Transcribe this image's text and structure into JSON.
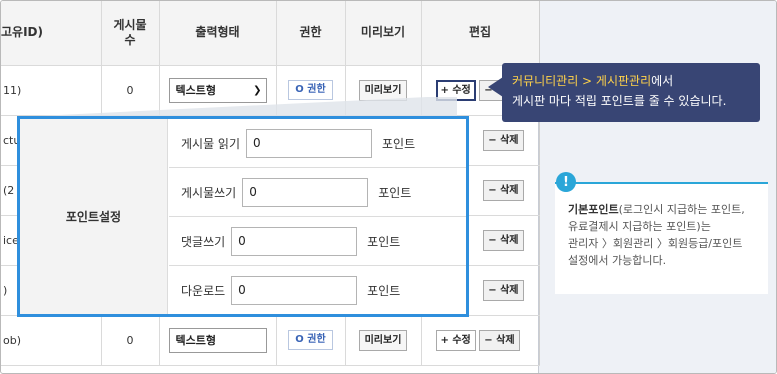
{
  "table": {
    "headers": {
      "id": "고유ID)",
      "count": "게시물\n수",
      "format": "출력형태",
      "perm": "권한",
      "preview": "미리보기",
      "edit": "편집"
    },
    "rows": [
      {
        "id": "11)",
        "count": "0",
        "format": "텍스트형",
        "perm": "O 권한",
        "preview": "미리보기",
        "edit": "+ 수정",
        "del": "− 삭제"
      },
      {
        "id": "ctu",
        "count": "",
        "format": "",
        "perm": "",
        "preview": "",
        "edit": "",
        "del": "− 삭제"
      },
      {
        "id": "(2",
        "count": "",
        "format": "",
        "perm": "",
        "preview": "",
        "edit": "",
        "del": "− 삭제"
      },
      {
        "id": "ice",
        "count": "",
        "format": "",
        "perm": "",
        "preview": "",
        "edit": "",
        "del": "− 삭제"
      },
      {
        "id": ")",
        "count": "",
        "format": "",
        "perm": "",
        "preview": "",
        "edit": "",
        "del": "− 삭제"
      },
      {
        "id": "ob)",
        "count": "0",
        "format": "텍스트형",
        "perm": "O 권한",
        "preview": "미리보기",
        "edit": "+ 수정",
        "del": "− 삭제"
      }
    ]
  },
  "point_setting": {
    "label": "포인트설정",
    "rows": [
      {
        "label": "게시물 읽기",
        "value": "0",
        "unit": "포인트"
      },
      {
        "label": "게시물쓰기",
        "value": "0",
        "unit": "포인트"
      },
      {
        "label": "댓글쓰기",
        "value": "0",
        "unit": "포인트"
      },
      {
        "label": "다운로드",
        "value": "0",
        "unit": "포인트"
      }
    ]
  },
  "tooltip": {
    "line1_highlight": "커뮤니티관리 > 게시판관리",
    "line1_rest": "에서",
    "line2": "게시판 마다 적립 포인트를 줄 수 있습니다."
  },
  "info": {
    "badge": "!",
    "bold": "기본포인트",
    "text1": "(로그인시 지급하는 포인트,",
    "text2": "유료결제시 지급하는 포인트)는",
    "text3": "관리자 〉회원관리 〉회원등급/포인트",
    "text4": "설정에서 가능합니다."
  },
  "colors": {
    "accent_blue": "#2f8fdd",
    "tooltip_bg": "#384574",
    "tooltip_highlight": "#ffd24a",
    "info_accent": "#2aa6d8"
  }
}
